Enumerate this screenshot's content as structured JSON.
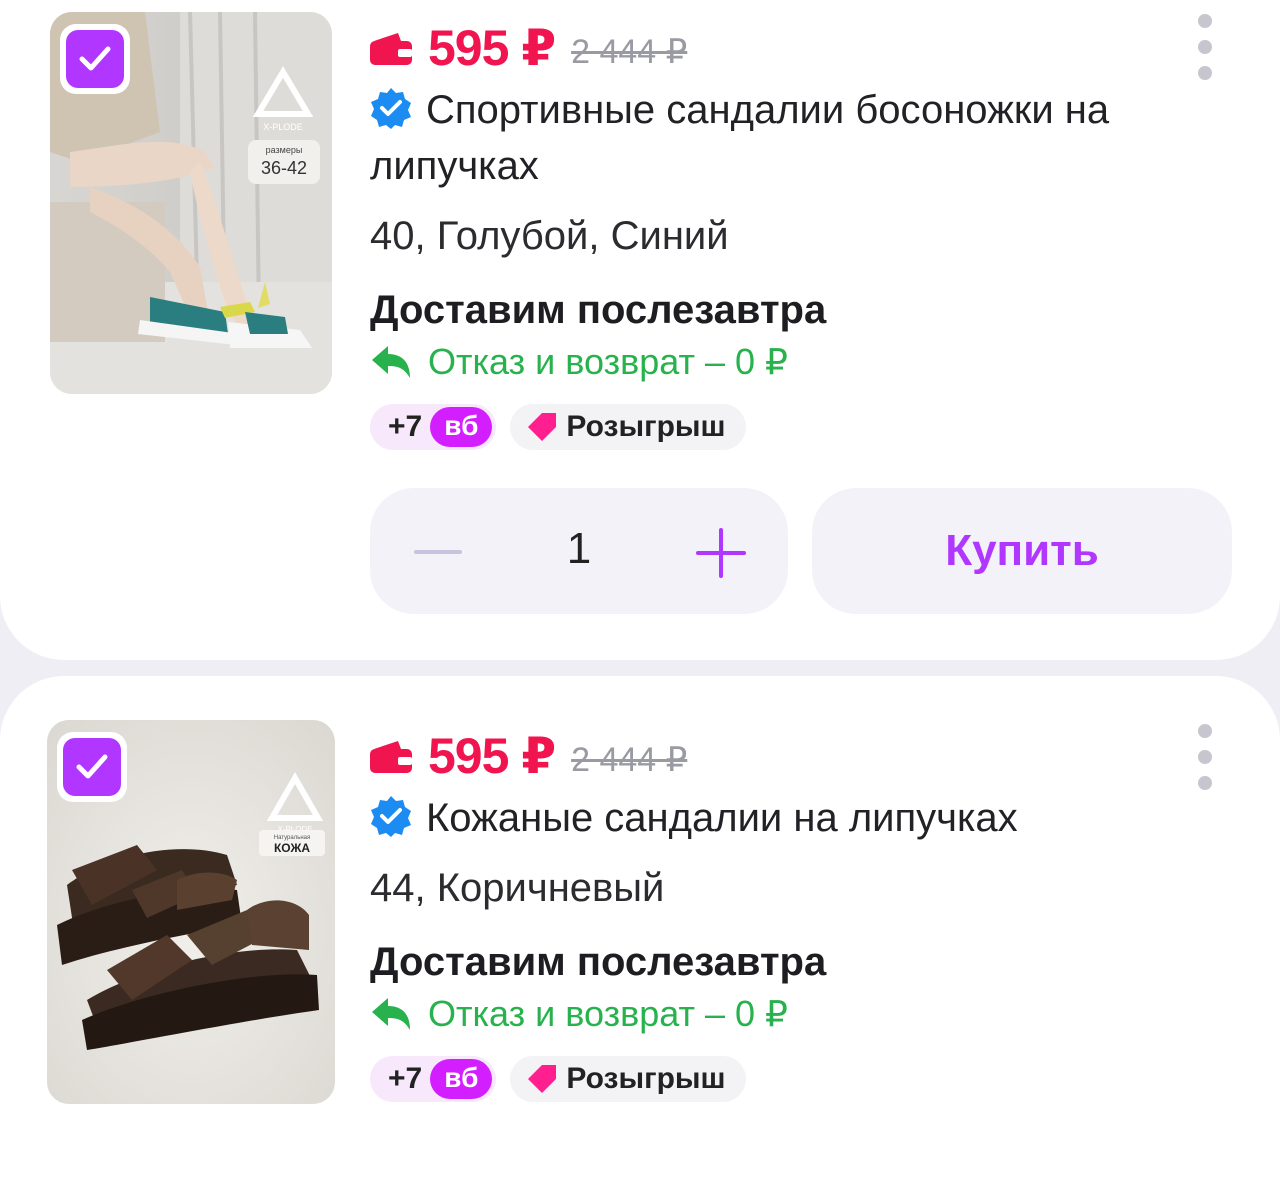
{
  "products": [
    {
      "price": "595 ₽",
      "old_price": "2 444 ₽",
      "title": "Спортивные сандалии босоножки на липучках",
      "variant": "40, Голубой, Синий",
      "delivery": "Доставим послезавтра",
      "return_text": "Отказ и возврат – 0 ₽",
      "points": "+7",
      "points_unit": "вб",
      "raffle": "Розыгрыш",
      "photo_brand": "X-PLODE",
      "photo_size_label": "размеры",
      "photo_size_value": "36-42",
      "selected": true
    },
    {
      "price": "595 ₽",
      "old_price": "2 444 ₽",
      "title": "Кожаные сандалии на липучках",
      "variant": "44, Коричневый",
      "delivery": "Доставим послезавтра",
      "return_text": "Отказ и возврат – 0 ₽",
      "points": "+7",
      "points_unit": "вб",
      "raffle": "Розыгрыш",
      "photo_brand": "X-PLODE",
      "photo_material_label": "Натуральная",
      "photo_material_value": "КОЖА",
      "selected": true
    }
  ],
  "cart": {
    "quantity": "1",
    "buy_label": "Купить"
  },
  "colors": {
    "accent": "#b136ff",
    "price": "#f0154f",
    "return": "#28b24e",
    "points_badge": "#d31fff"
  },
  "icons": [
    "check-icon",
    "wallet-icon",
    "verified-icon",
    "return-arrow-icon",
    "raffle-tag-icon",
    "minus-icon",
    "plus-icon",
    "more-vertical-icon"
  ]
}
